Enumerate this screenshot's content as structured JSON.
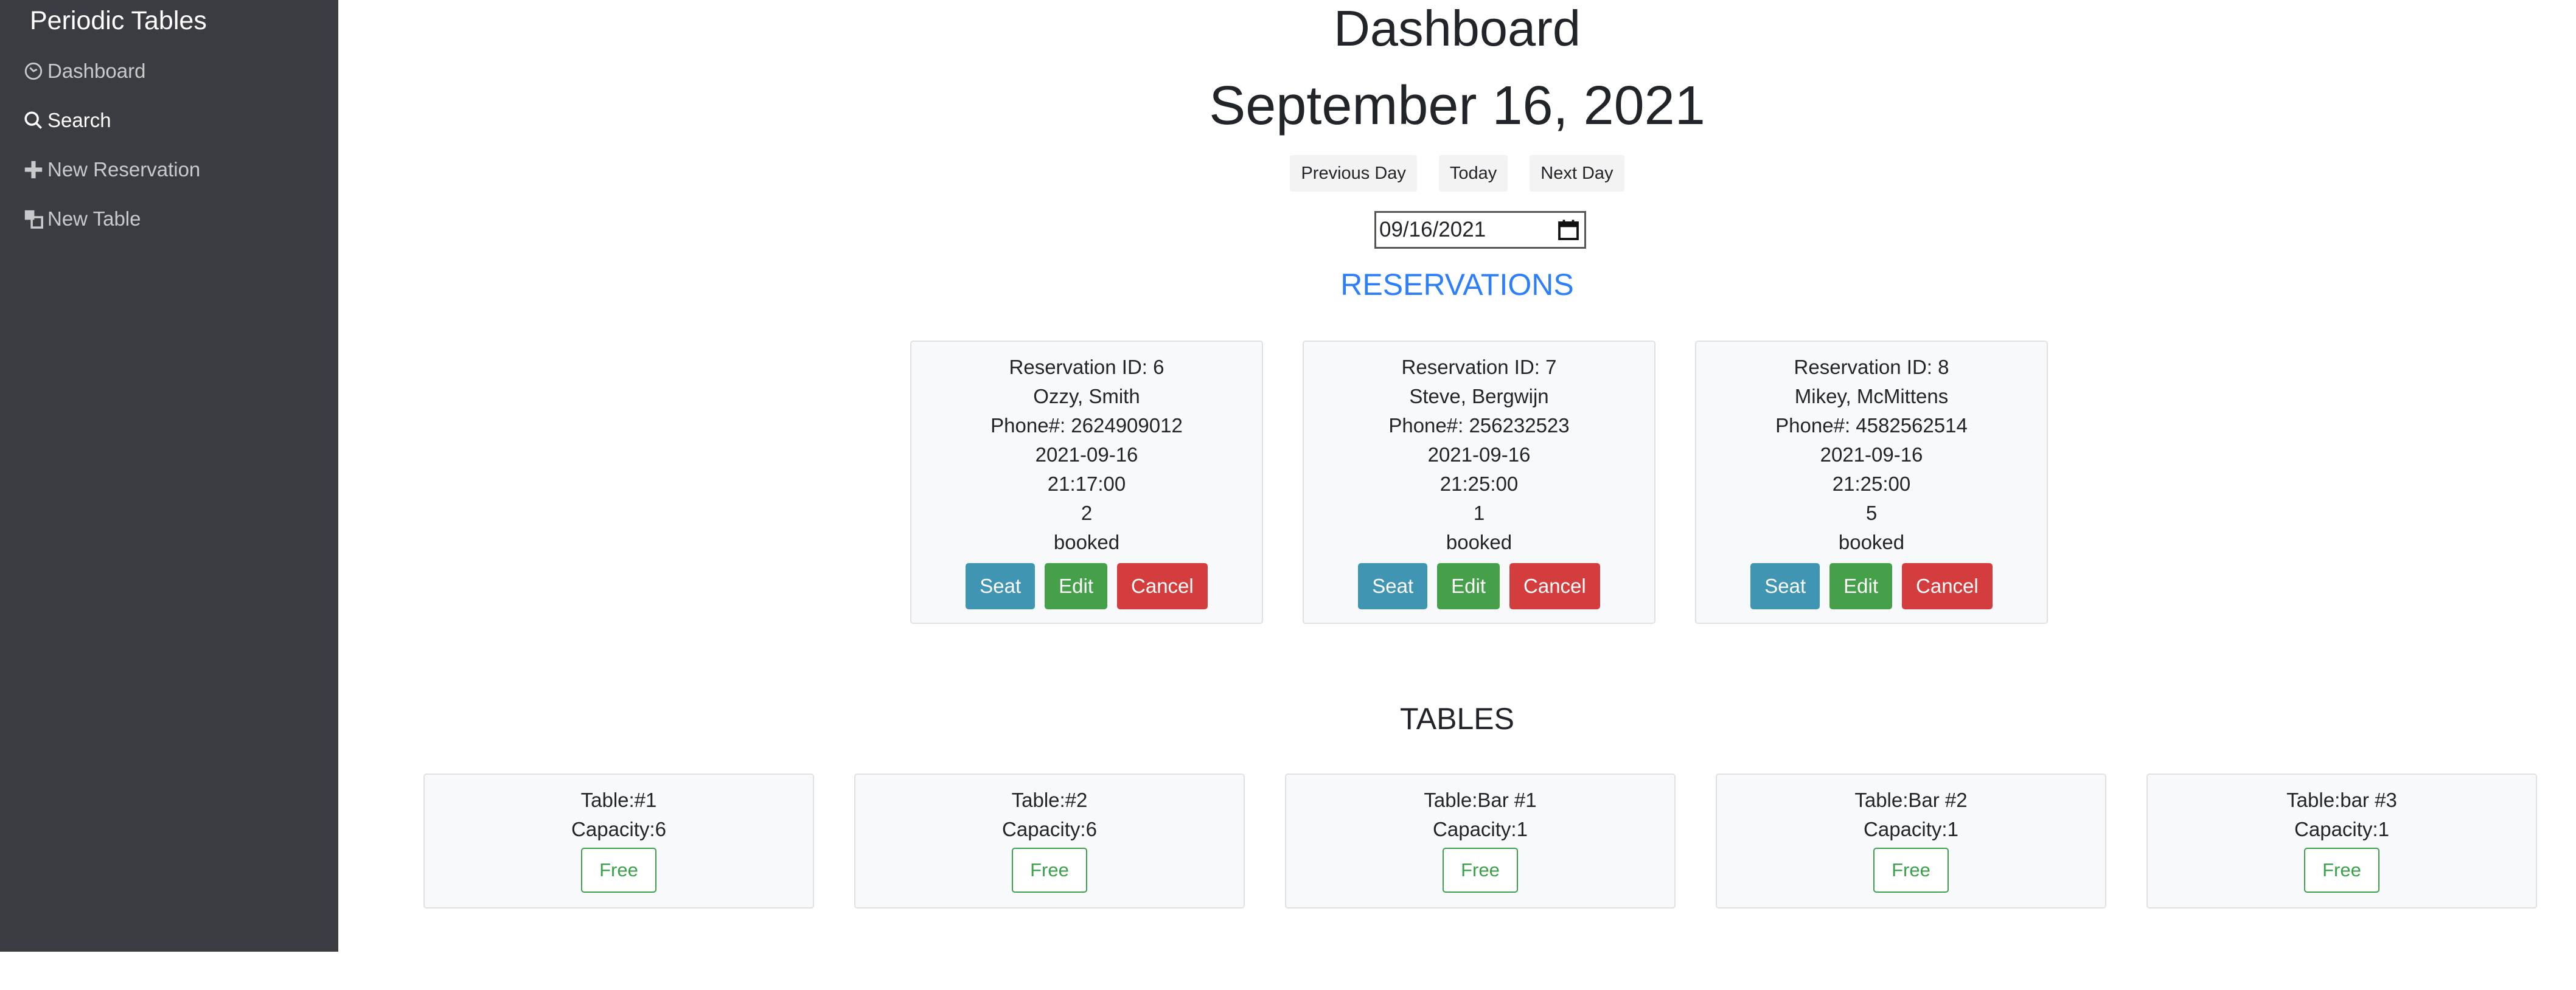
{
  "sidebar": {
    "brand": "Periodic Tables",
    "items": [
      {
        "label": "Dashboard",
        "icon": "dashboard-icon"
      },
      {
        "label": "Search",
        "icon": "search-icon"
      },
      {
        "label": "New Reservation",
        "icon": "plus-icon"
      },
      {
        "label": "New Table",
        "icon": "table-icon"
      }
    ]
  },
  "main": {
    "title": "Dashboard",
    "date_heading": "September 16, 2021",
    "nav": {
      "previous": "Previous Day",
      "today": "Today",
      "next": "Next Day"
    },
    "date_input": "09/16/2021",
    "reservations_heading": "RESERVATIONS",
    "tables_heading": "TABLES"
  },
  "reservations": [
    {
      "id_line": "Reservation ID: 6",
      "name": "Ozzy, Smith",
      "phone": "Phone#: 2624909012",
      "date": "2021-09-16",
      "time": "21:17:00",
      "people": "2",
      "status": "booked"
    },
    {
      "id_line": "Reservation ID: 7",
      "name": "Steve, Bergwijn",
      "phone": "Phone#: 256232523",
      "date": "2021-09-16",
      "time": "21:25:00",
      "people": "1",
      "status": "booked"
    },
    {
      "id_line": "Reservation ID: 8",
      "name": "Mikey, McMittens",
      "phone": "Phone#: 4582562514",
      "date": "2021-09-16",
      "time": "21:25:00",
      "people": "5",
      "status": "booked"
    }
  ],
  "reservation_actions": {
    "seat": "Seat",
    "edit": "Edit",
    "cancel": "Cancel"
  },
  "tables": [
    {
      "name": "Table:#1",
      "capacity": "Capacity:6",
      "status": "Free"
    },
    {
      "name": "Table:#2",
      "capacity": "Capacity:6",
      "status": "Free"
    },
    {
      "name": "Table:Bar #1",
      "capacity": "Capacity:1",
      "status": "Free"
    },
    {
      "name": "Table:Bar #2",
      "capacity": "Capacity:1",
      "status": "Free"
    },
    {
      "name": "Table:bar #3",
      "capacity": "Capacity:1",
      "status": "Free"
    }
  ],
  "colors": {
    "sidebar_bg": "#3b3c41",
    "reservations_heading": "#2d7ff9",
    "seat_button": "#4095b3",
    "edit_button": "#45a049",
    "cancel_button": "#d43d3d",
    "free_status": "#3aa04a"
  }
}
